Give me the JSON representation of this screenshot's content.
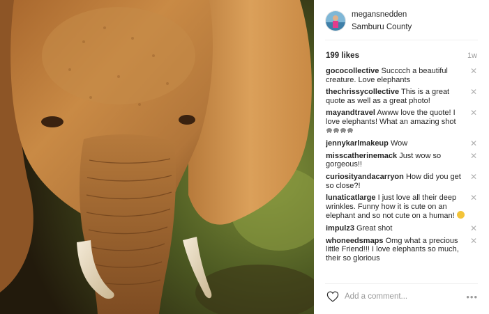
{
  "header": {
    "username": "megansnedden",
    "location": "Samburu County"
  },
  "likes": "199 likes",
  "age": "1w",
  "comments": [
    {
      "user": "gococollective",
      "text": "Succcch a beautiful creature. Love elephants"
    },
    {
      "user": "thechrissycollective",
      "text": "This is a great quote as well as a great photo!"
    },
    {
      "user": "mayandtravel",
      "text": "Awww love the quote! I love elephants! What an amazing shot"
    },
    {
      "user": "jennykarlmakeup",
      "text": "Wow"
    },
    {
      "user": "misscatherinemack",
      "text": "Just wow so gorgeous!!"
    },
    {
      "user": "curiosityandacarryon",
      "text": "How did you get so close?!"
    },
    {
      "user": "lunaticatlarge",
      "text": "I just love all their deep wrinkles. Funny how it is cute on an elephant and so not cute on a human!"
    },
    {
      "user": "impulz3",
      "text": "Great shot"
    },
    {
      "user": "whoneedsmaps",
      "text": "Omg what a precious little Friend!!! I love elephants so much, their so glorious"
    }
  ],
  "close_symbol": "✕",
  "add_comment_placeholder": "Add a comment...",
  "more_symbol": "•••",
  "icons": {
    "heart": "heart-icon",
    "elephant_emoji": "elephant-emoji",
    "laugh_emoji": "laughing-emoji"
  },
  "colors": {
    "text": "#262626",
    "muted": "#999999",
    "divider": "#efefef"
  }
}
